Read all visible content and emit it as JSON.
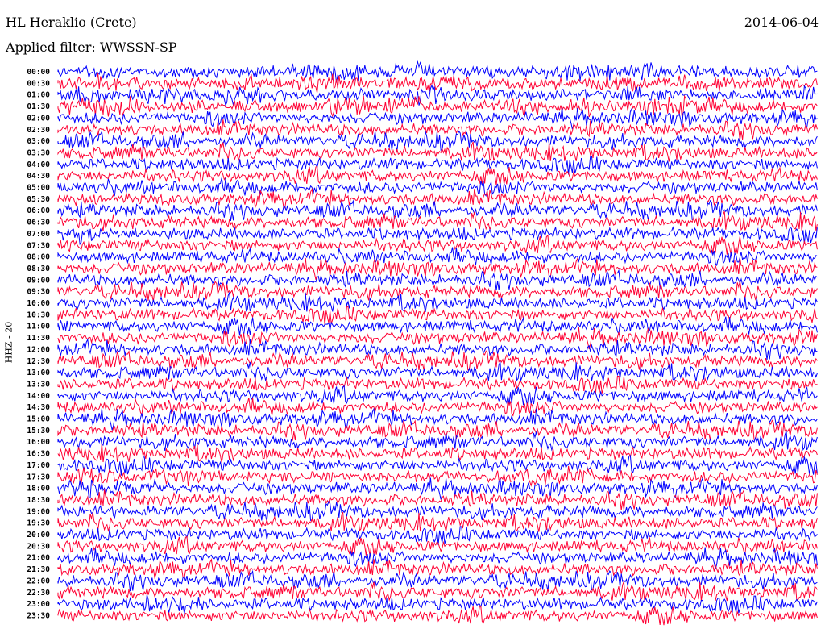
{
  "header": {
    "station": "HL Heraklio (Crete)",
    "date": "2014-06-04",
    "filter": "Applied filter: WWSSN-SP"
  },
  "chart_data": {
    "type": "line",
    "title": "HL Heraklio (Crete)",
    "ylabel": "HHZ - 20",
    "trace_colors": [
      "#0000ff",
      "#ff0033"
    ],
    "row_labels": [
      "00:00",
      "00:30",
      "01:00",
      "01:30",
      "02:00",
      "02:30",
      "03:00",
      "03:30",
      "04:00",
      "04:30",
      "05:00",
      "05:30",
      "06:00",
      "06:30",
      "07:00",
      "07:30",
      "08:00",
      "08:30",
      "09:00",
      "09:30",
      "10:00",
      "10:30",
      "11:00",
      "11:30",
      "12:00",
      "12:30",
      "13:00",
      "13:30",
      "14:00",
      "14:30",
      "15:00",
      "15:30",
      "16:00",
      "16:30",
      "17:00",
      "17:30",
      "18:00",
      "18:30",
      "19:00",
      "19:30",
      "20:00",
      "20:30",
      "21:00",
      "21:30",
      "22:00",
      "22:30",
      "23:00",
      "23:30"
    ]
  }
}
